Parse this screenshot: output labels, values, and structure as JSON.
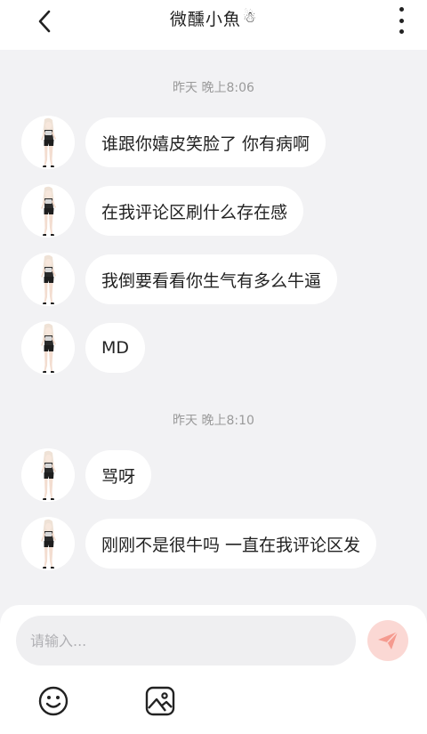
{
  "header": {
    "title": "微醺小魚",
    "title_emoji": "☃"
  },
  "messages": {
    "group1": {
      "timestamp": "昨天 晚上8:06",
      "items": [
        {
          "text": "谁跟你嬉皮笑脸了 你有病啊"
        },
        {
          "text": "在我评论区刷什么存在感"
        },
        {
          "text": "我倒要看看你生气有多么牛逼"
        },
        {
          "text": "MD"
        }
      ]
    },
    "group2": {
      "timestamp": "昨天 晚上8:10",
      "items": [
        {
          "text": "骂呀"
        },
        {
          "text": "刚刚不是很牛吗 一直在我评论区发"
        }
      ]
    }
  },
  "composer": {
    "placeholder": "请输入...",
    "send_icon": "paper-plane-icon",
    "tools": [
      "emoji-icon",
      "image-icon"
    ]
  },
  "colors": {
    "background": "#f2f2f4",
    "bubble": "#ffffff",
    "send_button": "#fbd8d4",
    "send_icon": "#f59a8f",
    "timestamp": "#9a9a9a"
  }
}
